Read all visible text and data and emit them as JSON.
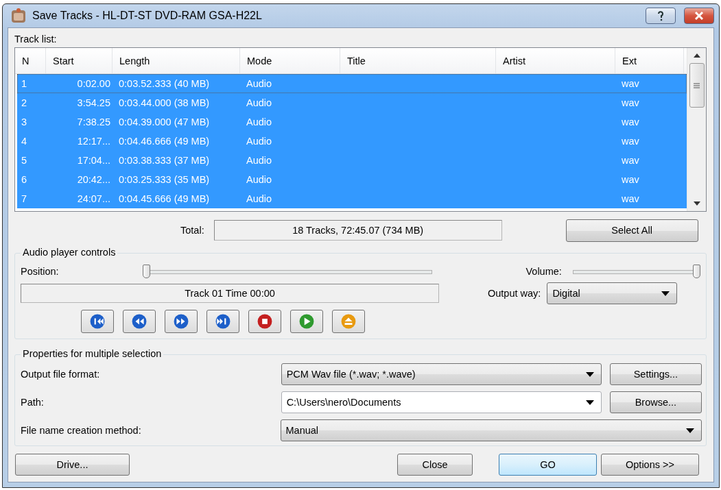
{
  "window": {
    "title": "Save Tracks - HL-DT-ST DVD-RAM GSA-H22L"
  },
  "track_list": {
    "label": "Track list:",
    "columns": [
      "N",
      "Start",
      "Length",
      "Mode",
      "Title",
      "Artist",
      "Ext"
    ],
    "rows": [
      {
        "cells": [
          "1",
          "0:02.00",
          "0:03.52.333 (40 MB)",
          "Audio",
          "",
          "",
          "wav"
        ],
        "selected": true,
        "focused": true
      },
      {
        "cells": [
          "2",
          "3:54.25",
          "0:03.44.000 (38 MB)",
          "Audio",
          "",
          "",
          "wav"
        ],
        "selected": true,
        "focused": false
      },
      {
        "cells": [
          "3",
          "7:38.25",
          "0:04.39.000 (47 MB)",
          "Audio",
          "",
          "",
          "wav"
        ],
        "selected": true,
        "focused": false
      },
      {
        "cells": [
          "4",
          "12:17...",
          "0:04.46.666 (49 MB)",
          "Audio",
          "",
          "",
          "wav"
        ],
        "selected": true,
        "focused": false
      },
      {
        "cells": [
          "5",
          "17:04...",
          "0:03.38.333 (37 MB)",
          "Audio",
          "",
          "",
          "wav"
        ],
        "selected": true,
        "focused": false
      },
      {
        "cells": [
          "6",
          "20:42...",
          "0:03.25.333 (35 MB)",
          "Audio",
          "",
          "",
          "wav"
        ],
        "selected": true,
        "focused": false
      },
      {
        "cells": [
          "7",
          "24:07...",
          "0:04.45.666 (49 MB)",
          "Audio",
          "",
          "",
          "wav"
        ],
        "selected": true,
        "focused": false
      }
    ]
  },
  "total": {
    "label": "Total:",
    "value": "18 Tracks,   72:45.07 (734 MB)"
  },
  "select_all_button": "Select All",
  "player": {
    "title": "Audio player controls",
    "position_label": "Position:",
    "position": {
      "level": 0
    },
    "volume_label": "Volume:",
    "volume": {
      "level": 1
    },
    "status": "Track 01 Time 00:00",
    "output_way_label": "Output way:",
    "output_way": "Digital"
  },
  "properties": {
    "title": "Properties for multiple selection",
    "rows": [
      {
        "label": "Output file format:",
        "value": "PCM Wav file (*.wav; *.wave)",
        "editable": false,
        "button": "Settings..."
      },
      {
        "label": "Path:",
        "value": "C:\\Users\\nero\\Documents",
        "editable": true,
        "button": "Browse..."
      },
      {
        "label": "File name creation method:",
        "value": "Manual",
        "editable": false
      }
    ]
  },
  "buttons": [
    {
      "label": "Drive...",
      "default": false
    },
    {
      "label": "Close",
      "default": false
    },
    {
      "label": "GO",
      "default": true
    },
    {
      "label": "Options >>",
      "default": false
    }
  ]
}
